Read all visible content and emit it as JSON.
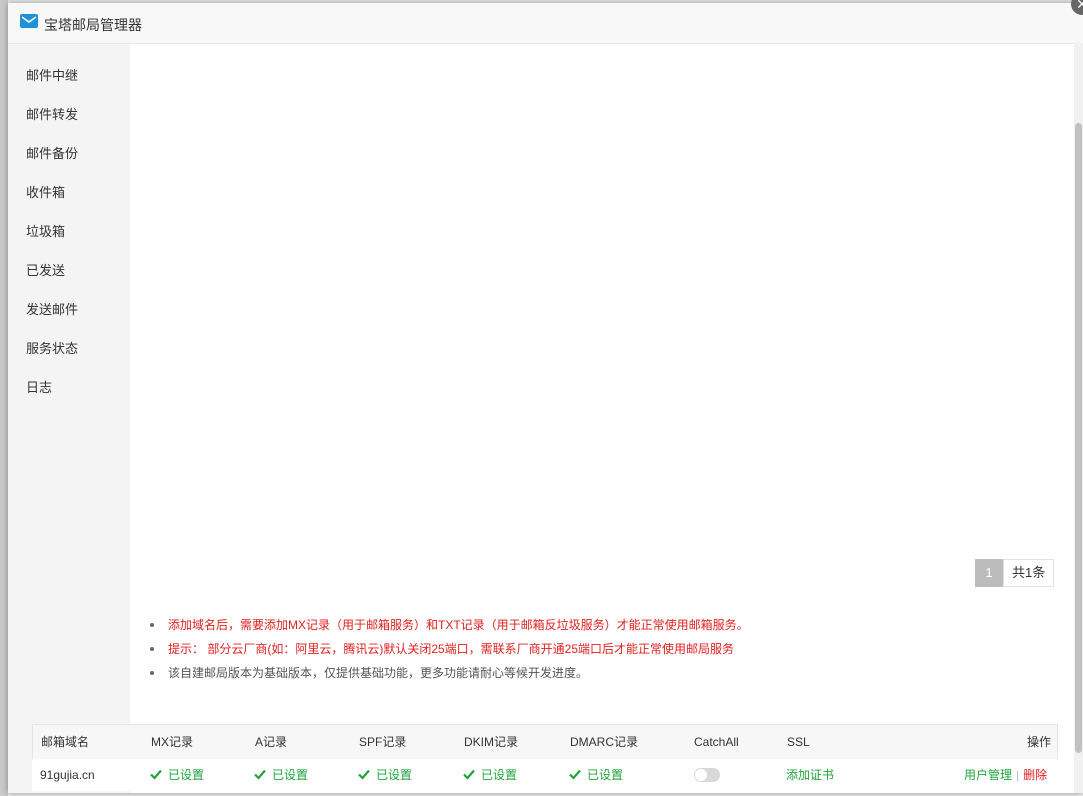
{
  "modal": {
    "title": "宝塔邮局管理器",
    "close_glyph": "✕"
  },
  "sidebar": {
    "items": [
      {
        "label": "邮件中继"
      },
      {
        "label": "邮件转发"
      },
      {
        "label": "邮件备份"
      },
      {
        "label": "收件箱"
      },
      {
        "label": "垃圾箱"
      },
      {
        "label": "已发送"
      },
      {
        "label": "发送邮件"
      },
      {
        "label": "服务状态"
      },
      {
        "label": "日志"
      }
    ]
  },
  "pagination": {
    "current": "1",
    "total": "共1条"
  },
  "notes": [
    {
      "text": "添加域名后，需要添加MX记录（用于邮箱服务）和TXT记录（用于邮箱反垃圾服务）才能正常使用邮箱服务。"
    },
    {
      "text": "提示： 部分云厂商(如：阿里云，腾讯云)默认关闭25端口，需联系厂商开通25端口后才能正常使用邮局服务"
    },
    {
      "text": "该自建邮局版本为基础版本，仅提供基础功能，更多功能请耐心等候开发进度。"
    }
  ],
  "table": {
    "headers": {
      "domain": "邮箱域名",
      "mx": "MX记录",
      "a": "A记录",
      "spf": "SPF记录",
      "dkim": "DKIM记录",
      "dmarc": "DMARC记录",
      "catchall": "CatchAll",
      "ssl": "SSL",
      "actions": "操作"
    },
    "rows": [
      {
        "domain": "91gujia.cn",
        "mx": "已设置",
        "a": "已设置",
        "spf": "已设置",
        "dkim": "已设置",
        "dmarc": "已设置",
        "catchall_on": false,
        "ssl": "添加证书",
        "action_users": "用户管理",
        "action_sep": "|",
        "action_delete": "删除"
      }
    ]
  },
  "colors": {
    "accent_green": "#20a53a",
    "warn_red": "#e02020"
  },
  "icons": {
    "title": "mail-icon",
    "check": "check-icon",
    "close": "close-icon"
  }
}
